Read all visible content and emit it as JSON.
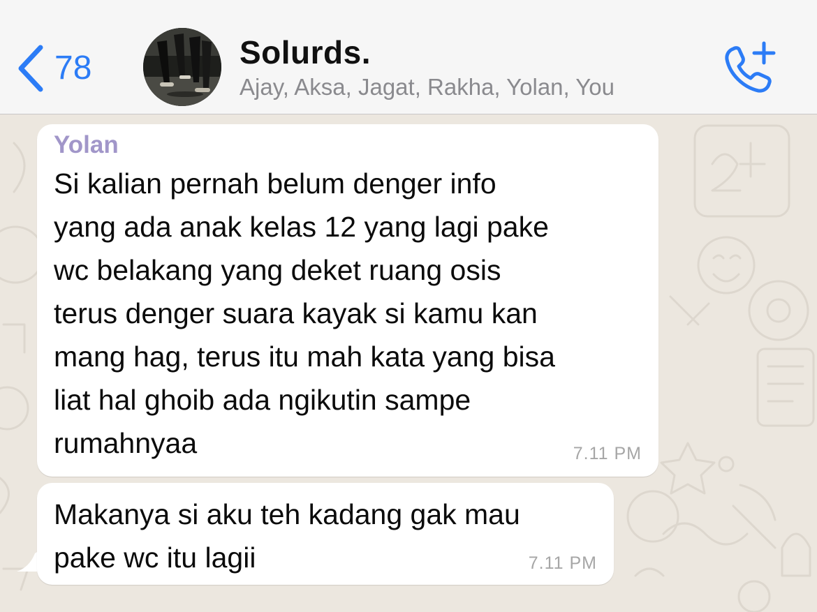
{
  "header": {
    "back_count": "78",
    "title": "Solurds.",
    "subtitle": "Ajay, Aksa, Jagat, Rakha, Yolan, You",
    "accent_color": "#2c7cf6",
    "back_icon": "chevron-left-icon",
    "call_icon": "add-call-icon"
  },
  "messages": [
    {
      "sender": "Yolan",
      "text": "Si kalian pernah belum denger info\nyang ada anak kelas 12 yang lagi pake\nwc belakang yang deket ruang osis\nterus denger suara kayak si kamu kan\nmang hag, terus itu mah kata yang bisa\nliat hal ghoib ada ngikutin sampe\nrumahnyaa",
      "time": "7.11 PM"
    },
    {
      "text": "Makanya si aku teh kadang gak mau\npake wc itu lagii",
      "time": "7.11 PM"
    }
  ]
}
